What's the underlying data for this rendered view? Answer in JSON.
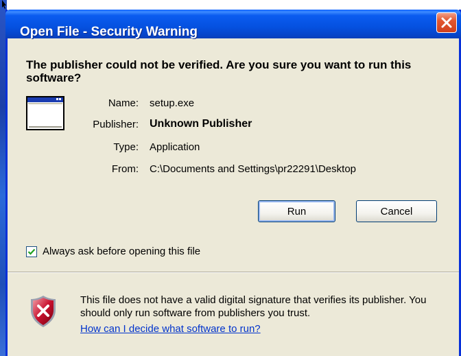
{
  "window": {
    "title": "Open File - Security Warning",
    "close_icon": "close-icon"
  },
  "question": "The publisher could not be verified.  Are you sure you want to run this software?",
  "file_icon": "application-window-icon",
  "details": {
    "name_label": "Name:",
    "name_value": "setup.exe",
    "publisher_label": "Publisher:",
    "publisher_value": "Unknown Publisher",
    "type_label": "Type:",
    "type_value": "Application",
    "from_label": "From:",
    "from_value": "C:\\Documents and Settings\\pr22291\\Desktop"
  },
  "buttons": {
    "run": "Run",
    "cancel": "Cancel"
  },
  "checkbox": {
    "label": "Always ask before opening this file",
    "checked": true
  },
  "warning": {
    "icon": "shield-error-icon",
    "text": "This file does not have a valid digital signature that verifies its publisher.  You should only run software from publishers you trust.",
    "link": "How can I decide what software to run?"
  },
  "colors": {
    "titlebar": "#0551e0",
    "dialog_bg": "#ece9d8",
    "close_red": "#e2562f",
    "link": "#0033cc",
    "shield_red": "#c8102e"
  }
}
